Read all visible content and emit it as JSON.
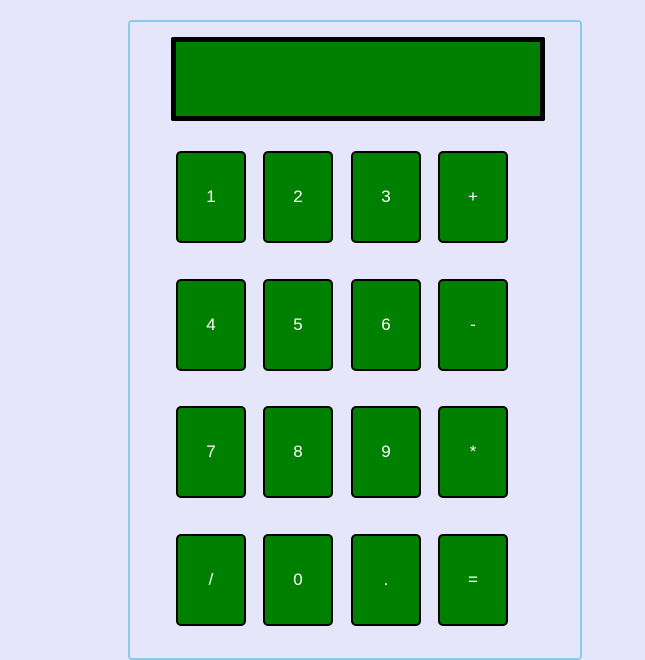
{
  "display": {
    "value": ""
  },
  "keys": {
    "k1": "1",
    "k2": "2",
    "k3": "3",
    "plus": "+",
    "k4": "4",
    "k5": "5",
    "k6": "6",
    "minus": "-",
    "k7": "7",
    "k8": "8",
    "k9": "9",
    "multiply": "*",
    "divide": "/",
    "k0": "0",
    "dot": ".",
    "equals": "="
  },
  "colors": {
    "background": "#e6e6fa",
    "frame_border": "#87ceeb",
    "display_bg": "#008000",
    "key_bg": "#008000",
    "key_text": "#ffffff",
    "border": "#000000"
  }
}
